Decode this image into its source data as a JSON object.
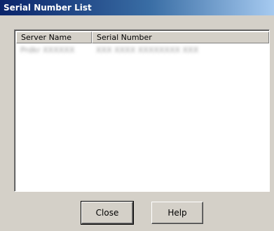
{
  "window": {
    "title": "Serial Number List"
  },
  "list": {
    "columns": [
      "Server Name",
      "Serial Number"
    ],
    "rows": [
      {
        "server_name": "Prdkr XXXXXX",
        "serial_number": "XXX XXXX XXXXXXXX XXX"
      }
    ]
  },
  "buttons": {
    "close_label": "Close",
    "help_label": "Help"
  }
}
